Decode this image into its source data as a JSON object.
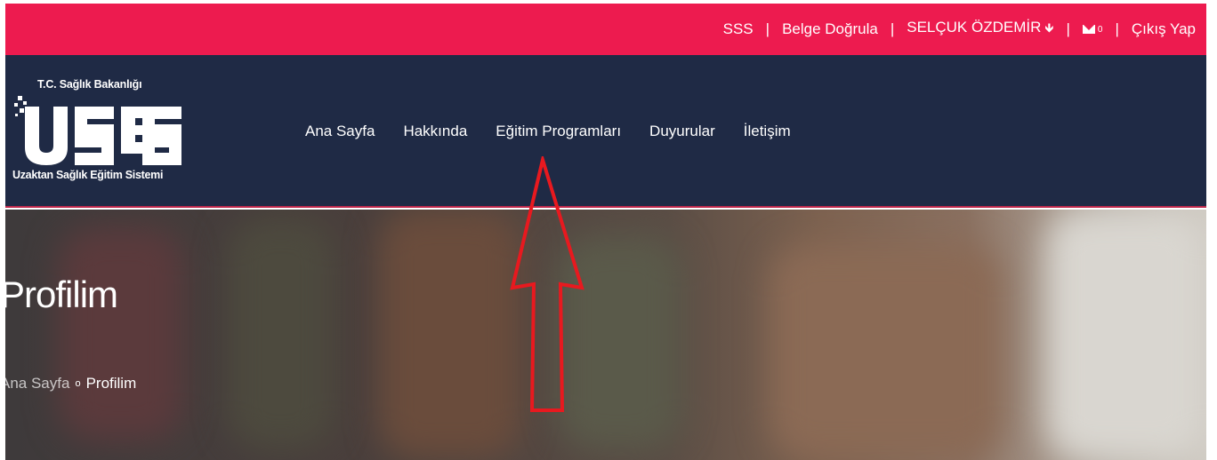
{
  "topbar": {
    "links": {
      "faq": "SSS",
      "verify": "Belge Doğrula",
      "user": "SELÇUK ÖZDEMİR",
      "mail_count": "0",
      "logout": "Çıkış Yap"
    },
    "separator": "|"
  },
  "logo": {
    "top_text": "T.C. Sağlık Bakanlığı",
    "mark": "USES",
    "bottom_text": "Uzaktan Sağlık Eğitim Sistemi"
  },
  "nav": {
    "items": [
      "Ana Sayfa",
      "Hakkında",
      "Eğitim Programları",
      "Duyurular",
      "İletişim"
    ]
  },
  "hero": {
    "title": "Profilim",
    "breadcrumb": {
      "home": "Ana Sayfa",
      "sep": "o",
      "current": "Profilim"
    }
  },
  "colors": {
    "topbar": "#ed1b4f",
    "navbar": "#1f2a45",
    "annotation": "#e8191f"
  }
}
